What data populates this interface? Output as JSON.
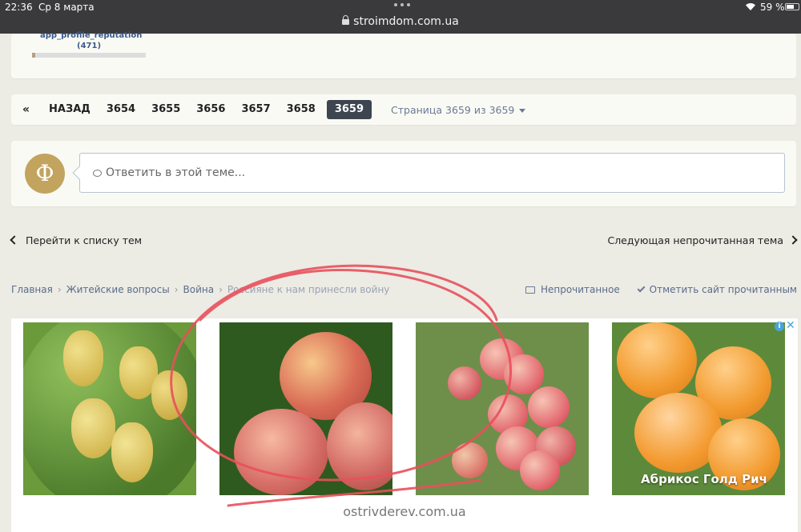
{
  "status_bar": {
    "time": "22:36",
    "date": "Ср 8 марта",
    "url": "stroimdom.com.ua",
    "battery": "59 %"
  },
  "reputation": {
    "label": "app_profile_reputation",
    "count": "(471)",
    "level_fraction": 0.03
  },
  "pagination": {
    "first": "«",
    "back": "НАЗАД",
    "pages": [
      "3654",
      "3655",
      "3656",
      "3657",
      "3658"
    ],
    "current": "3659",
    "page_info": "Страница 3659 из 3659"
  },
  "reply": {
    "avatar_letter": "Ф",
    "placeholder": "Ответить в этой теме..."
  },
  "navigation": {
    "prev": "Перейти к списку тем",
    "next": "Следующая непрочитанная тема"
  },
  "breadcrumb": {
    "items": [
      "Главная",
      "Житейские вопросы",
      "Война"
    ],
    "current": "Россияне к нам принесли войну",
    "unread": "Непрочитанное",
    "mark_read": "Отметить сайт прочитанным"
  },
  "ad": {
    "caption": "Абрикос Голд Рич",
    "domain": "ostrivderev.com.ua",
    "info": "i",
    "close": "✕",
    "images": [
      "pears",
      "peaches",
      "apples",
      "apricots"
    ]
  },
  "colors": {
    "accent_avatar": "#c2a45f",
    "active_page": "#3d4550",
    "link": "#5a6c8a",
    "annotation": "#e8505b"
  }
}
